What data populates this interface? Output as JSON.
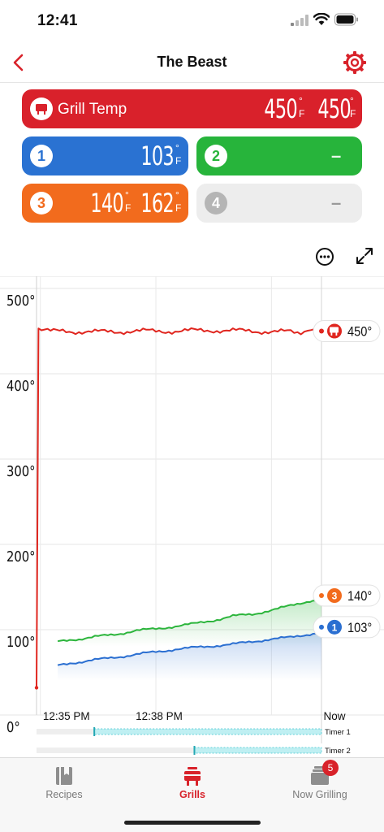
{
  "status": {
    "time": "12:41"
  },
  "nav": {
    "title": "The Beast"
  },
  "cards": {
    "grill": {
      "label": "Grill Temp",
      "temp1": "450",
      "temp2": "450",
      "unit": "F",
      "color": "#d9212b"
    },
    "probe1": {
      "badge": "1",
      "temp": "103",
      "unit": "F",
      "color": "#2a72d2"
    },
    "probe2": {
      "badge": "2",
      "placeholder": "–",
      "color": "#27b43b"
    },
    "probe3": {
      "badge": "3",
      "temp1": "140",
      "temp2": "162",
      "unit": "F",
      "color": "#f26b1d"
    },
    "probe4": {
      "badge": "4",
      "placeholder": "–",
      "color": "#ededed"
    }
  },
  "chart_data": {
    "type": "line",
    "y_ticks": [
      "500°",
      "400°",
      "300°",
      "200°",
      "100°",
      "0°"
    ],
    "ylim": [
      0,
      500
    ],
    "x_ticks": [
      "12:35 PM",
      "12:38 PM",
      "Now"
    ],
    "x_tick_minutes": [
      0,
      3,
      7.3
    ],
    "xlim_minutes": [
      -0.1,
      7.3
    ],
    "grid": true,
    "series": [
      {
        "key": "grill",
        "color": "#e0261f",
        "x": [
          -0.1,
          -0.05,
          0.5,
          1.5,
          2.5,
          3.5,
          4.5,
          5.5,
          6.5,
          7.3
        ],
        "values": [
          32,
          450,
          450,
          449,
          450,
          450,
          451,
          450,
          449,
          450
        ]
      },
      {
        "key": "probe3",
        "color": "#2cb53c",
        "x": [
          0.45,
          1.0,
          1.5,
          2.0,
          2.5,
          3.0,
          3.5,
          4.0,
          4.5,
          5.0,
          5.5,
          6.0,
          6.5,
          7.0,
          7.3
        ],
        "values": [
          88,
          89,
          92,
          95,
          99,
          101,
          104,
          107,
          111,
          116,
          118,
          123,
          128,
          134,
          136
        ]
      },
      {
        "key": "probe1",
        "color": "#2b6fd1",
        "x": [
          0.45,
          1.0,
          1.5,
          2.0,
          2.5,
          3.0,
          3.5,
          4.0,
          4.5,
          5.0,
          5.5,
          6.0,
          6.5,
          7.0,
          7.3
        ],
        "values": [
          60,
          62,
          65,
          68,
          71,
          74,
          77,
          79,
          81,
          83,
          86,
          89,
          91,
          95,
          98
        ]
      }
    ],
    "callouts": [
      {
        "key": "grill",
        "value": "450°"
      },
      {
        "key": "probe3",
        "badge": "3",
        "value": "140°"
      },
      {
        "key": "probe1",
        "badge": "1",
        "value": "103°"
      }
    ],
    "timers": [
      {
        "label": "Timer 1",
        "start_minutes": 1.4,
        "end_minutes": 7.3
      },
      {
        "label": "Timer 2",
        "start_minutes": 4.0,
        "end_minutes": 7.3
      }
    ]
  },
  "tabs": [
    {
      "label": "Recipes",
      "icon": "book-icon",
      "active": false
    },
    {
      "label": "Grills",
      "icon": "grill-icon",
      "active": true
    },
    {
      "label": "Now Grilling",
      "icon": "tray-icon",
      "active": false,
      "badge": "5"
    }
  ],
  "colors": {
    "accent": "#d8222a"
  }
}
